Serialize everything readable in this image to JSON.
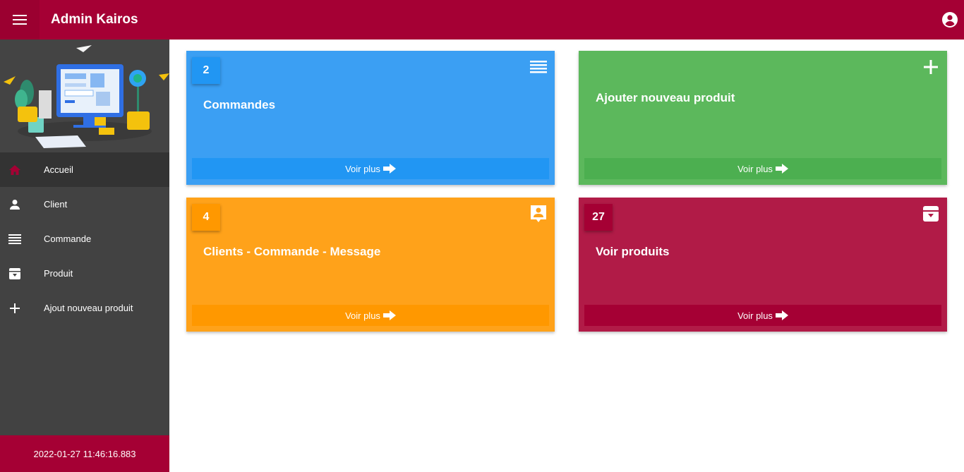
{
  "header": {
    "title": "Admin Kairos",
    "menu_icon": "hamburger-menu-icon",
    "account_icon": "account-circle-icon",
    "bg_color": "#a50034"
  },
  "sidebar": {
    "illustration": "dashboard-workspace-illustration",
    "items": [
      {
        "label": "Accueil",
        "icon": "home-icon",
        "active": true
      },
      {
        "label": "Client",
        "icon": "person-icon",
        "active": false
      },
      {
        "label": "Commande",
        "icon": "list-icon",
        "active": false
      },
      {
        "label": "Produit",
        "icon": "archive-box-icon",
        "active": false
      },
      {
        "label": "Ajout nouveau produit",
        "icon": "plus-icon",
        "active": false
      }
    ],
    "footer_datetime": "2022-01-27 11:46:16.883"
  },
  "cards": [
    {
      "count": "2",
      "title": "Commandes",
      "link": "Voir plus",
      "icon": "list-icon",
      "color": "#3b9ff3"
    },
    {
      "count": "",
      "title": "Ajouter nouveau produit",
      "link": "Voir plus",
      "icon": "plus-icon",
      "color": "#5cb85c"
    },
    {
      "count": "4",
      "title": "Clients - Commande - Message",
      "link": "Voir plus",
      "icon": "contact-card-icon",
      "color": "#ffa21a"
    },
    {
      "count": "27",
      "title": "Voir produits",
      "link": "Voir plus",
      "icon": "archive-box-icon",
      "color": "#b11b47"
    }
  ]
}
